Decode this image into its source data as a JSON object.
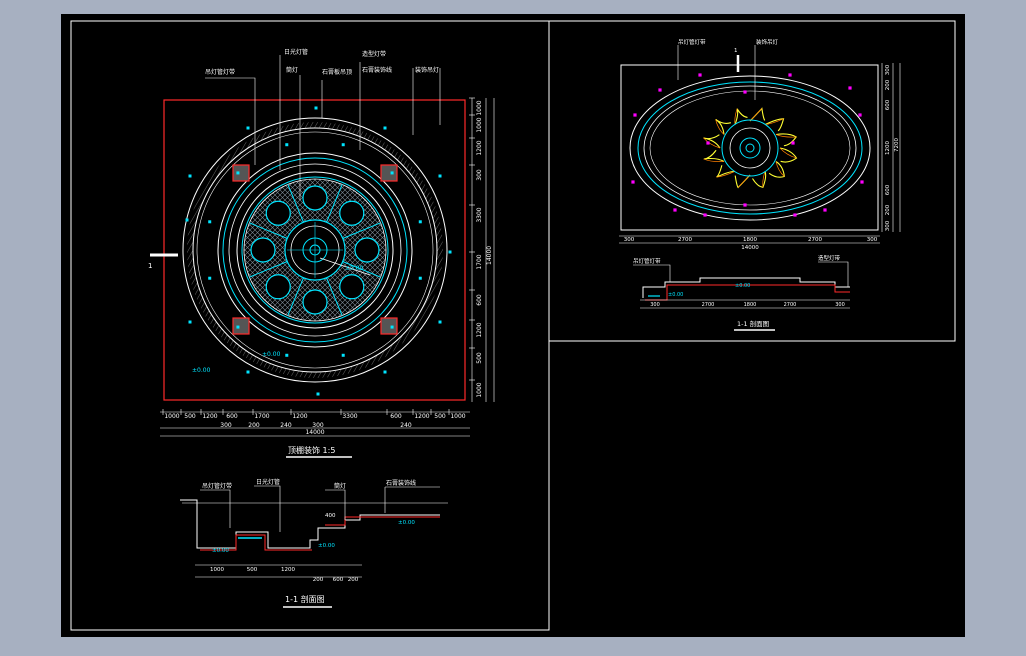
{
  "colors": {
    "desktop": "#a7b0c1",
    "paper": "#000000",
    "line": "#ffffff",
    "cyan": "#00e5ff",
    "red": "#ff2a2a",
    "yellow": "#ffff33",
    "magenta": "#ff00ff",
    "orange": "#ff7f00"
  },
  "left_plan": {
    "title": "顶棚装饰 1:5",
    "callouts": [
      "吊灯管灯带",
      "日光灯管",
      "筒灯",
      "石膏板吊顶",
      "造型灯带",
      "石膏装饰线",
      "装饰吊灯"
    ],
    "dims_bottom_top": [
      "1000",
      "500",
      "1200",
      "600",
      "1700",
      "1200",
      "3300",
      "600",
      "1200",
      "500",
      "1000"
    ],
    "dims_bottom_mid": [
      "300",
      "200",
      "240",
      "300",
      "240"
    ],
    "dims_bottom_total": "14000",
    "dims_right_inner": [
      "1000",
      "1000",
      "1200",
      "300",
      "3300",
      "1700",
      "600",
      "1200",
      "500",
      "1000"
    ],
    "dims_right_total": "14000",
    "elevation_marks": [
      "±0.00",
      "±0.00",
      "±0.00"
    ],
    "section_mark": "1"
  },
  "left_section": {
    "title": "1-1 剖面图",
    "callouts": [
      "吊灯管灯带",
      "日光灯管",
      "筒灯",
      "石膏装饰线"
    ],
    "dims": [
      "1000",
      "500",
      "1200",
      "200",
      "600",
      "200"
    ],
    "dim_small": "400",
    "elevation_marks": [
      "±0.00",
      "±0.00",
      "±0.00"
    ]
  },
  "right_plan": {
    "callouts": [
      "吊灯管灯带",
      "装饰吊灯"
    ],
    "section_mark": "1",
    "dims_bottom": [
      "300",
      "2700",
      "1800",
      "2700",
      "300"
    ],
    "dims_bottom_total": "14000",
    "dims_right_inner": [
      "300",
      "200",
      "600",
      "1200",
      "600",
      "200",
      "300"
    ],
    "dims_right_total": "7200"
  },
  "right_section": {
    "title": "1-1 剖面图",
    "callouts": [
      "吊灯管灯带",
      "造型灯带"
    ],
    "dims": [
      "300",
      "2700",
      "1800",
      "2700",
      "300"
    ],
    "elevation_marks": [
      "±0.00",
      "±0.00"
    ]
  }
}
